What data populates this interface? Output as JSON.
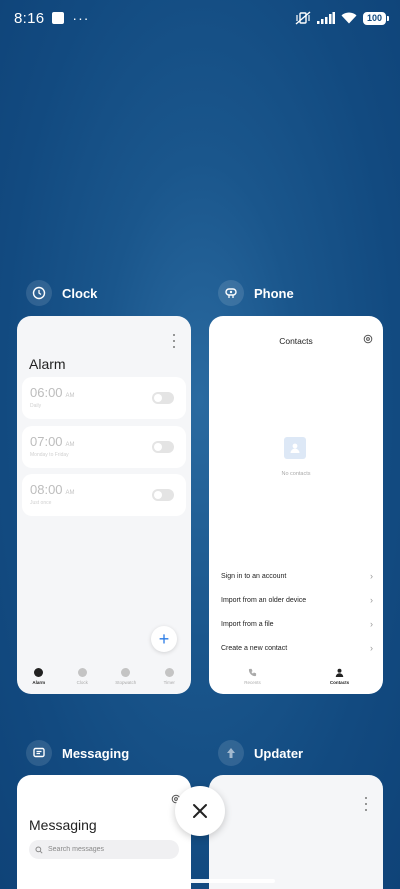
{
  "status_bar": {
    "time": "8:16",
    "dots": "···",
    "battery": "100"
  },
  "apps": [
    {
      "title": "Clock"
    },
    {
      "title": "Phone"
    },
    {
      "title": "Messaging"
    },
    {
      "title": "Updater"
    }
  ],
  "clock": {
    "title": "Alarm",
    "alarms": [
      {
        "time": "06:00",
        "ampm": "AM",
        "repeat": "Daily",
        "enabled": false
      },
      {
        "time": "07:00",
        "ampm": "AM",
        "repeat": "Monday to Friday",
        "enabled": false
      },
      {
        "time": "08:00",
        "ampm": "AM",
        "repeat": "Just once",
        "enabled": false
      }
    ],
    "fab_label": "+",
    "nav": [
      "Alarm",
      "Clock",
      "Stopwatch",
      "Timer"
    ]
  },
  "phone": {
    "title": "Contacts",
    "empty_text": "No contacts",
    "menu": [
      "Sign in to an account",
      "Import from an older device",
      "Import from a file",
      "Create a new contact"
    ],
    "nav": [
      "Recents",
      "Contacts"
    ]
  },
  "messaging": {
    "title": "Messaging",
    "search_placeholder": "Search messages"
  },
  "colors": {
    "background": "#124a80",
    "accent": "#2a7be6"
  }
}
